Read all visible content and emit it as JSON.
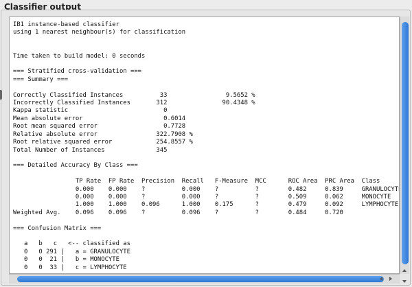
{
  "panel": {
    "title": "Classifier output"
  },
  "output": {
    "text": "IB1 instance-based classifier\nusing 1 nearest neighbour(s) for classification\n\n\nTime taken to build model: 0 seconds\n\n=== Stratified cross-validation ===\n=== Summary ===\n\nCorrectly Classified Instances          33                9.5652 %\nIncorrectly Classified Instances       312               90.4348 %\nKappa statistic                          0\nMean absolute error                      0.6014\nRoot mean squared error                  0.7728\nRelative absolute error                322.7908 %\nRoot relative squared error            254.8557 %\nTotal Number of Instances              345\n\n=== Detailed Accuracy By Class ===\n\n                 TP Rate  FP Rate  Precision  Recall   F-Measure  MCC      ROC Area  PRC Area  Class\n                 0.000    0.000    ?          0.000    ?          ?        0.482     0.839     GRANULOCYTE\n                 0.000    0.000    ?          0.000    ?          ?        0.509     0.062     MONOCYTE\n                 1.000    1.000    0.096      1.000    0.175      ?        0.479     0.092     LYMPHOCYTE\nWeighted Avg.    0.096    0.096    ?          0.096    ?          ?        0.484     0.720\n\n=== Confusion Matrix ===\n\n   a   b   c   <-- classified as\n   0   0 291 |   a = GRANULOCYTE\n   0   0  21 |   b = MONOCYTE\n   0   0  33 |   c = LYMPHOCYTE"
  },
  "icons": {
    "scroll_up": "up-arrow-icon",
    "scroll_down": "down-arrow-icon",
    "scroll_left": "left-arrow-icon",
    "scroll_right": "right-arrow-icon"
  },
  "colors": {
    "scroll_thumb": "#2e78d6",
    "text_background": "#ffffff",
    "panel_background": "#ececec"
  }
}
